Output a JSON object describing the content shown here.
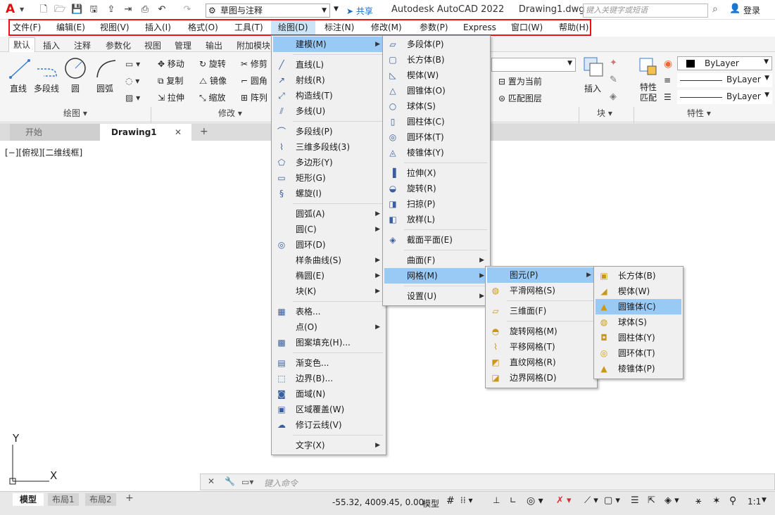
{
  "titlebar": {
    "logo": "A",
    "workspace": "草图与注释",
    "share": "共享",
    "app_title": "Autodesk AutoCAD 2022",
    "doc_title": "Drawing1.dwg",
    "search_placeholder": "键入关键字或短语",
    "login": "登录"
  },
  "menubar": {
    "items": [
      "文件(F)",
      "编辑(E)",
      "视图(V)",
      "插入(I)",
      "格式(O)",
      "工具(T)",
      "绘图(D)",
      "标注(N)",
      "修改(M)",
      "参数(P)",
      "Express",
      "窗口(W)",
      "帮助(H)"
    ]
  },
  "ribbon_tabs": [
    "默认",
    "插入",
    "注释",
    "参数化",
    "视图",
    "管理",
    "输出",
    "附加模块"
  ],
  "ribbon": {
    "draw": {
      "line": "直线",
      "polyline": "多段线",
      "circle": "圆",
      "arc": "圆弧",
      "panel": "绘图"
    },
    "modify": {
      "move": "移动",
      "rotate": "旋转",
      "trim": "修剪",
      "copy": "复制",
      "mirror": "镜像",
      "fillet": "圆角",
      "stretch": "拉伸",
      "scale": "缩放",
      "array": "阵列",
      "panel": "修改"
    },
    "layers": {
      "set_current": "置为当前",
      "match_layer": "匹配图层"
    },
    "block": {
      "insert": "插入",
      "panel": "块"
    },
    "properties": {
      "match": "特性\n匹配",
      "color": "ByLayer",
      "linetype": "ByLayer",
      "lineweight": "ByLayer",
      "panel": "特性"
    }
  },
  "doc_tabs": {
    "start": "开始",
    "drawing": "Drawing1"
  },
  "viewport_label": "[−][俯视][二维线框]",
  "menu_draw": [
    {
      "label": "建模(M)",
      "icon": "",
      "sub": true,
      "hl": true
    },
    {
      "sep": true
    },
    {
      "label": "直线(L)",
      "icon": "╱"
    },
    {
      "label": "射线(R)",
      "icon": "↗"
    },
    {
      "label": "构造线(T)",
      "icon": "⤢"
    },
    {
      "label": "多线(U)",
      "icon": "⫽"
    },
    {
      "sep": true
    },
    {
      "label": "多段线(P)",
      "icon": "⌒"
    },
    {
      "label": "三维多段线(3)",
      "icon": "⌇"
    },
    {
      "label": "多边形(Y)",
      "icon": "⬠"
    },
    {
      "label": "矩形(G)",
      "icon": "▭"
    },
    {
      "label": "螺旋(I)",
      "icon": "§"
    },
    {
      "sep": true
    },
    {
      "label": "圆弧(A)",
      "icon": "",
      "sub": true
    },
    {
      "label": "圆(C)",
      "icon": "",
      "sub": true
    },
    {
      "label": "圆环(D)",
      "icon": "◎"
    },
    {
      "label": "样条曲线(S)",
      "icon": "",
      "sub": true
    },
    {
      "label": "椭圆(E)",
      "icon": "",
      "sub": true
    },
    {
      "label": "块(K)",
      "icon": "",
      "sub": true
    },
    {
      "sep": true
    },
    {
      "label": "表格...",
      "icon": "▦"
    },
    {
      "label": "点(O)",
      "icon": "",
      "sub": true
    },
    {
      "label": "图案填充(H)...",
      "icon": "▩"
    },
    {
      "sep": true
    },
    {
      "label": "渐变色...",
      "icon": "▤"
    },
    {
      "label": "边界(B)...",
      "icon": "⬚"
    },
    {
      "label": "面域(N)",
      "icon": "◙"
    },
    {
      "label": "区域覆盖(W)",
      "icon": "▣"
    },
    {
      "label": "修订云线(V)",
      "icon": "☁"
    },
    {
      "sep": true
    },
    {
      "label": "文字(X)",
      "icon": "",
      "sub": true
    }
  ],
  "menu_modeling": [
    {
      "label": "多段体(P)",
      "icon": "▱"
    },
    {
      "label": "长方体(B)",
      "icon": "▢"
    },
    {
      "label": "楔体(W)",
      "icon": "◺"
    },
    {
      "label": "圆锥体(O)",
      "icon": "△"
    },
    {
      "label": "球体(S)",
      "icon": "○"
    },
    {
      "label": "圆柱体(C)",
      "icon": "▯"
    },
    {
      "label": "圆环体(T)",
      "icon": "◎"
    },
    {
      "label": "棱锥体(Y)",
      "icon": "◬"
    },
    {
      "sep": true
    },
    {
      "label": "拉伸(X)",
      "icon": "▐"
    },
    {
      "label": "旋转(R)",
      "icon": "◒"
    },
    {
      "label": "扫掠(P)",
      "icon": "◨"
    },
    {
      "label": "放样(L)",
      "icon": "◧"
    },
    {
      "sep": true
    },
    {
      "label": "截面平面(E)",
      "icon": "◈"
    },
    {
      "sep": true
    },
    {
      "label": "曲面(F)",
      "icon": "",
      "sub": true
    },
    {
      "label": "网格(M)",
      "icon": "",
      "sub": true,
      "hl": true
    },
    {
      "sep": true
    },
    {
      "label": "设置(U)",
      "icon": "",
      "sub": true
    }
  ],
  "menu_mesh": [
    {
      "label": "图元(P)",
      "icon": "",
      "sub": true,
      "hl": true
    },
    {
      "label": "平滑网格(S)",
      "icon": "◍"
    },
    {
      "sep": true
    },
    {
      "label": "三维面(F)",
      "icon": "▱"
    },
    {
      "sep": true
    },
    {
      "label": "旋转网格(M)",
      "icon": "◓"
    },
    {
      "label": "平移网格(T)",
      "icon": "⌇"
    },
    {
      "label": "直纹网格(R)",
      "icon": "◩"
    },
    {
      "label": "边界网格(D)",
      "icon": "◪"
    }
  ],
  "menu_primitives": [
    {
      "label": "长方体(B)",
      "icon": "▣"
    },
    {
      "label": "楔体(W)",
      "icon": "◢"
    },
    {
      "label": "圆锥体(C)",
      "icon": "▲",
      "hl": true
    },
    {
      "label": "球体(S)",
      "icon": "◍"
    },
    {
      "label": "圆柱体(Y)",
      "icon": "◘"
    },
    {
      "label": "圆环体(T)",
      "icon": "◎"
    },
    {
      "label": "棱锥体(P)",
      "icon": "▲"
    }
  ],
  "ucs": {
    "x": "X",
    "y": "Y"
  },
  "command": {
    "placeholder": "键入命令"
  },
  "status": {
    "tabs": [
      "模型",
      "布局1",
      "布局2"
    ],
    "coords": "-55.32, 4009.45, 0.00",
    "mode": "模型",
    "scale": "1:1"
  }
}
